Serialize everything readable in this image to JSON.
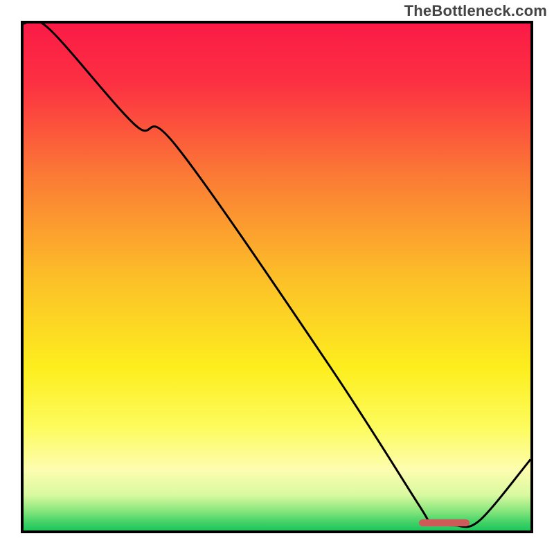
{
  "watermark": "TheBottleneck.com",
  "chart_data": {
    "type": "line",
    "title": "",
    "xlabel": "",
    "ylabel": "",
    "xlim": [
      0,
      100
    ],
    "ylim": [
      0,
      100
    ],
    "grid": false,
    "legend": false,
    "series": [
      {
        "name": "curve",
        "x": [
          0,
          5,
          22,
          30,
          60,
          78,
          80,
          85,
          90,
          100
        ],
        "values": [
          100,
          99,
          80,
          76,
          33,
          5,
          2,
          1,
          2,
          14
        ]
      }
    ],
    "gradient_stops": [
      {
        "offset": 0.0,
        "color": "#fb1a46"
      },
      {
        "offset": 0.12,
        "color": "#fc3142"
      },
      {
        "offset": 0.3,
        "color": "#fb7a35"
      },
      {
        "offset": 0.5,
        "color": "#fcbf28"
      },
      {
        "offset": 0.68,
        "color": "#fdee1e"
      },
      {
        "offset": 0.8,
        "color": "#fdfc60"
      },
      {
        "offset": 0.88,
        "color": "#fdfdb0"
      },
      {
        "offset": 0.93,
        "color": "#d9f9a0"
      },
      {
        "offset": 0.96,
        "color": "#8ce77f"
      },
      {
        "offset": 0.985,
        "color": "#3fd166"
      },
      {
        "offset": 1.0,
        "color": "#1fc75d"
      }
    ],
    "optimal_range_x": [
      78,
      88
    ],
    "optimal_marker_y": 1.5,
    "optimal_marker_color": "#cf5a5a"
  }
}
